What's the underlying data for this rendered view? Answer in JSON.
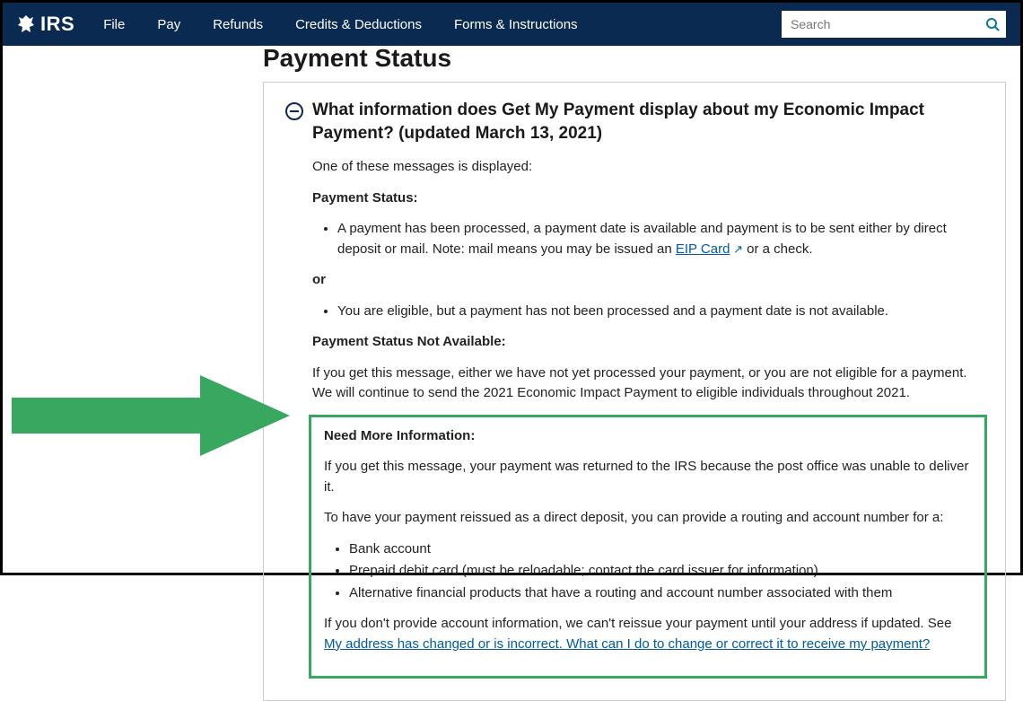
{
  "header": {
    "brand": "IRS",
    "nav": [
      "File",
      "Pay",
      "Refunds",
      "Credits & Deductions",
      "Forms & Instructions"
    ],
    "search_placeholder": "Search"
  },
  "page_title": "Payment Status",
  "accordion": {
    "title": "What information does Get My Payment display about my Economic Impact Payment? (updated March 13, 2021)",
    "intro": "One of these messages is displayed:",
    "section1_heading": "Payment Status:",
    "section1_bullet_pre": "A payment has been processed, a payment date is available and payment is to be sent either by direct deposit or mail. Note: mail means you may be issued an ",
    "section1_bullet_link": "EIP Card",
    "section1_bullet_post": " or a check.",
    "or_label": "or",
    "section1_bullet2": "You are eligible, but a payment has not been processed and a payment date is not available.",
    "section2_heading": "Payment Status Not Available:",
    "section2_para": "If you get this message, either we have not yet processed your payment, or you are not eligible for a payment. We will continue to send the 2021 Economic Impact Payment to eligible individuals throughout 2021.",
    "section3_heading": "Need More Information:",
    "section3_para1": "If you get this message, your payment was returned to the IRS because the post office was unable to deliver it.",
    "section3_para2": "To have your payment reissued as a direct deposit, you can provide a routing and account number for a:",
    "section3_bullets": [
      "Bank account",
      "Prepaid debit card (must be reloadable; contact the card issuer for information)",
      "Alternative financial products that have a routing and account number associated with them"
    ],
    "section3_para3_pre": "If you don't provide account information, we can't reissue your payment until your address if updated. See ",
    "section3_para3_link": "My address has changed or is incorrect. What can I do to change or correct it to receive my payment?"
  }
}
